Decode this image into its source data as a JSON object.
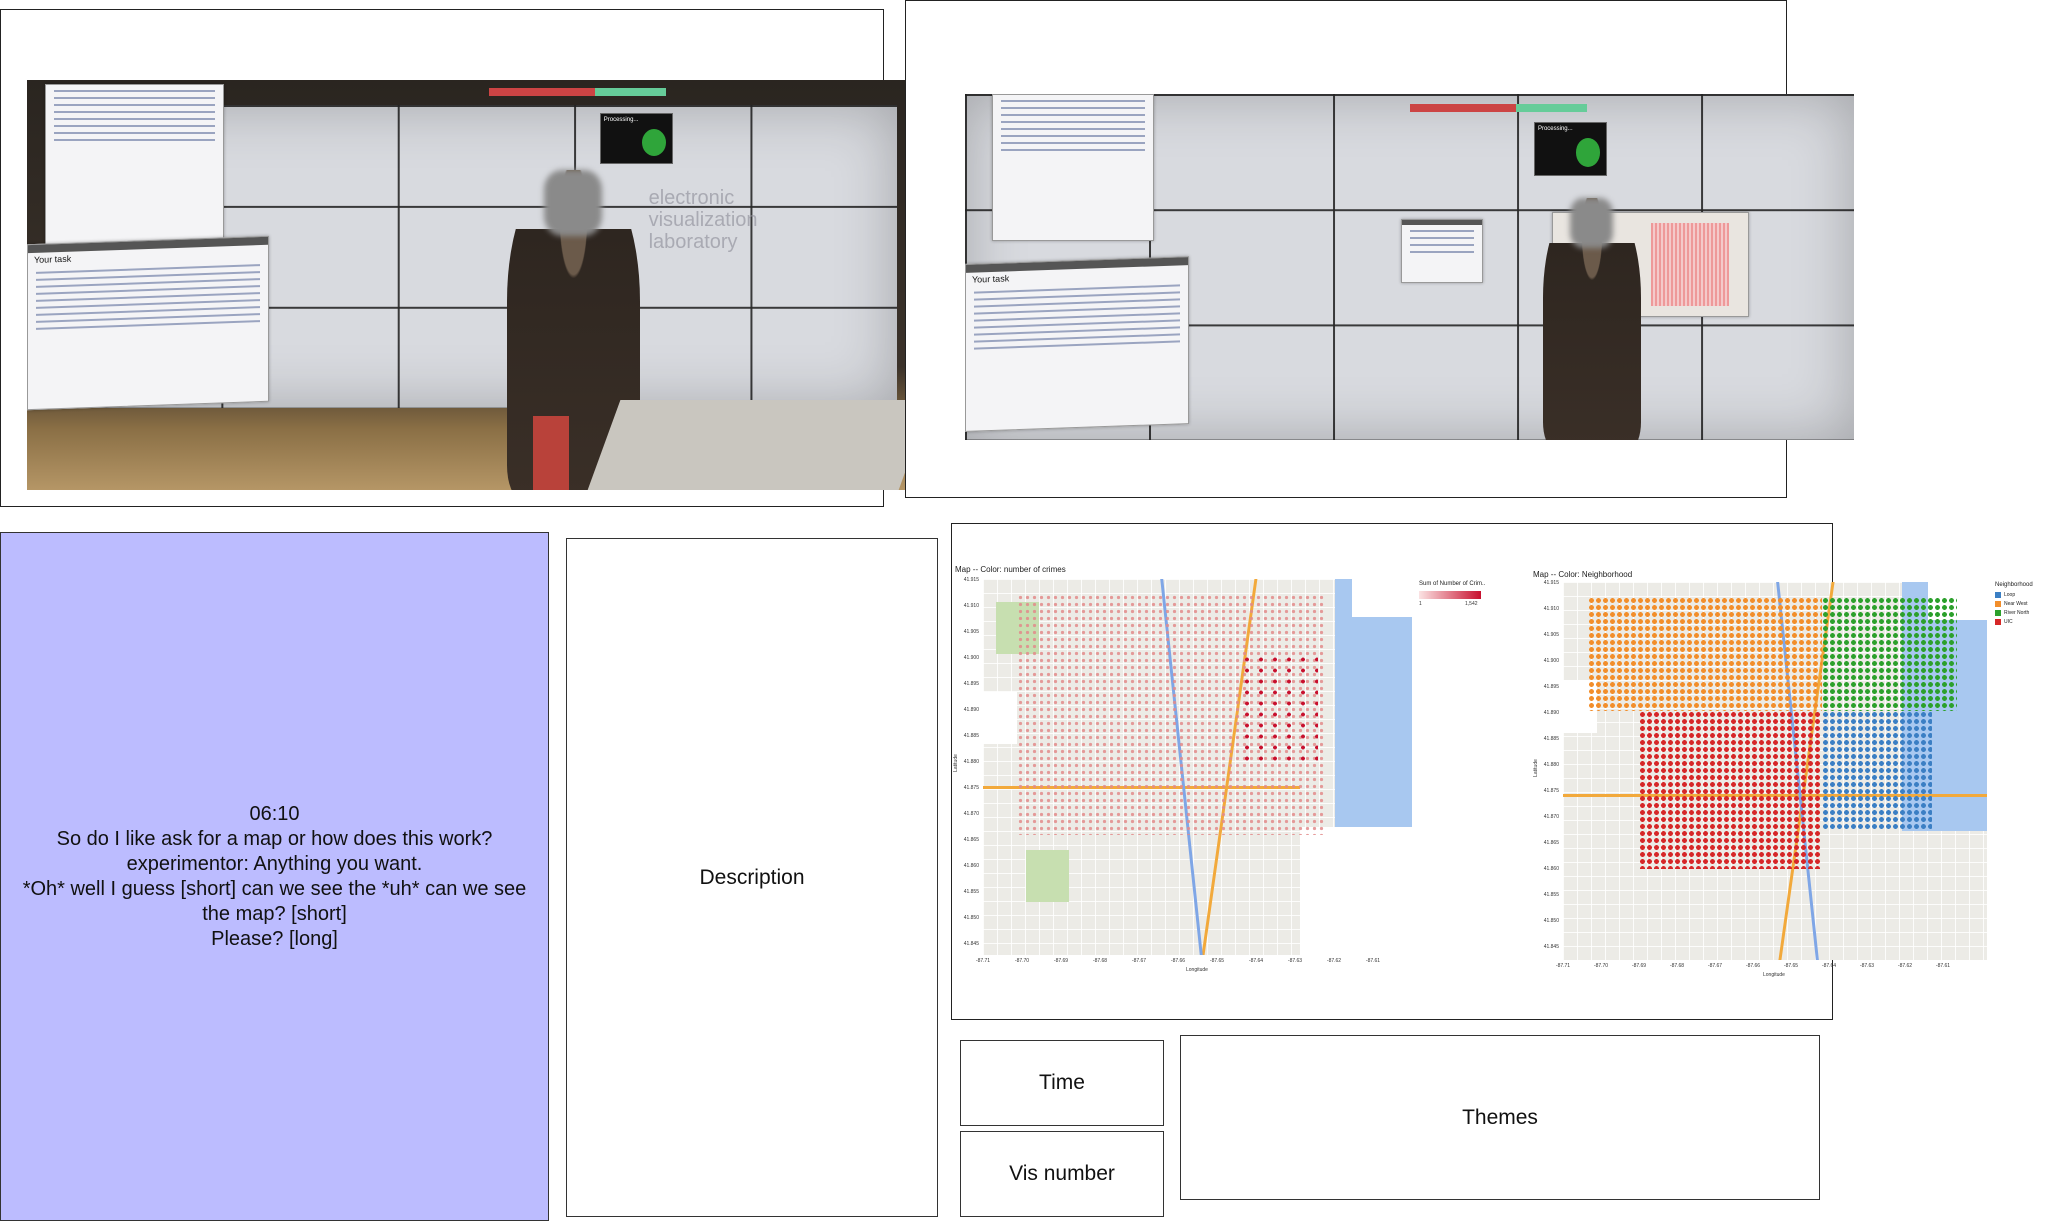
{
  "transcript": {
    "timestamp": "06:10",
    "lines": [
      "So do I like ask for a map or how does this work?",
      "experimentor: Anything you want.",
      "*Oh* well I guess [short] can we see the *uh* can we see the map? [short]",
      "Please? [long]"
    ]
  },
  "panels": {
    "description_label": "Description",
    "time_label": "Time",
    "vis_number_label": "Vis number",
    "themes_label": "Themes"
  },
  "photos": {
    "wall_doc_bar": "Task Description.png",
    "wall_doc_heading": "Your task",
    "wall_logo": [
      "electronic",
      "visualization",
      "laboratory"
    ],
    "popup_text": "Processing..."
  },
  "maps": {
    "left": {
      "title": "Map -- Color: number of crimes",
      "legend_title": "Sum of Number of Crim..",
      "legend_min": "1",
      "legend_max": "1,542",
      "ramp_colors": [
        "#fbe3e3",
        "#c8102e"
      ]
    },
    "right": {
      "title": "Map -- Color: Neighborhood",
      "legend_title": "Neighborhood",
      "legend_items": [
        {
          "name": "Loop",
          "color": "#3b7fc4"
        },
        {
          "name": "Near West",
          "color": "#f28e2b"
        },
        {
          "name": "River North",
          "color": "#2ca02c"
        },
        {
          "name": "UIC",
          "color": "#d62728"
        }
      ]
    },
    "y_ticks": [
      "41.915",
      "41.910",
      "41.905",
      "41.900",
      "41.895",
      "41.890",
      "41.885",
      "41.880",
      "41.875",
      "41.870",
      "41.865",
      "41.860",
      "41.855",
      "41.850",
      "41.845"
    ],
    "x_ticks": [
      "-87.71",
      "-87.70",
      "-87.69",
      "-87.68",
      "-87.67",
      "-87.66",
      "-87.65",
      "-87.64",
      "-87.63",
      "-87.62",
      "-87.61"
    ],
    "x_label": "Longitude",
    "y_label": "Latitude"
  }
}
